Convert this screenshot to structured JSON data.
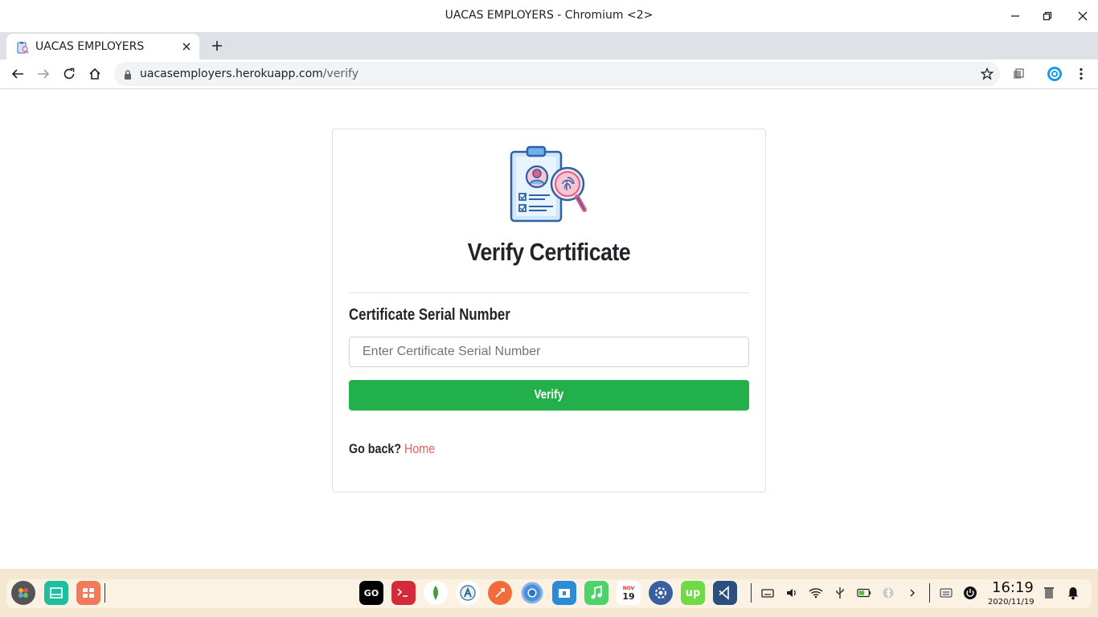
{
  "window": {
    "title": "UACAS EMPLOYERS - Chromium <2>"
  },
  "tabs": [
    {
      "title": "UACAS EMPLOYERS",
      "active": true
    }
  ],
  "address_bar": {
    "host": "uacasemployers.herokuapp.com",
    "path": "/verify"
  },
  "page": {
    "heading": "Verify Certificate",
    "field_label": "Certificate Serial Number",
    "serial_input": {
      "value": "",
      "placeholder": "Enter Certificate Serial Number"
    },
    "verify_label": "Verify",
    "go_back_text": "Go back?",
    "home_link": "Home"
  },
  "taskbar": {
    "apps": [
      "goland",
      "terminal",
      "mongodb-compass",
      "android-studio",
      "postman",
      "chromium",
      "files",
      "music",
      "calendar",
      "system-settings",
      "upwork",
      "vscode"
    ],
    "calendar_month": "NOV",
    "calendar_day": "19",
    "clock": {
      "time": "16:19",
      "date": "2020/11/19"
    }
  },
  "colors": {
    "verify_button": "#22b04b",
    "home_link": "#e35d5b",
    "taskbar_bg": "#f5e8d3"
  }
}
